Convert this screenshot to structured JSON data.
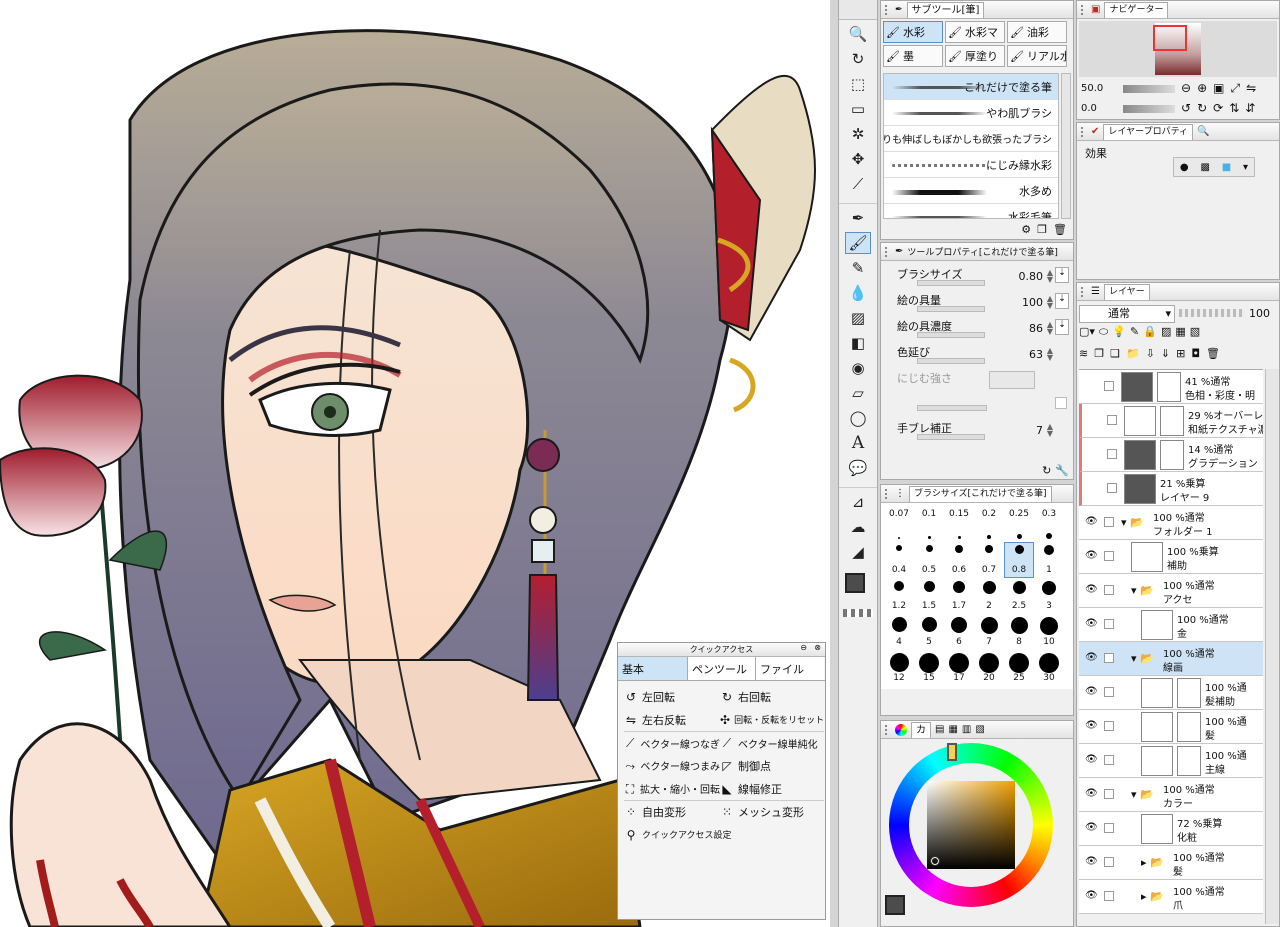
{
  "subtool": {
    "title": "サブツール[筆]",
    "groups": [
      "水彩",
      "水彩マ",
      "油彩",
      "墨",
      "厚塗り",
      "リアル水"
    ],
    "brushes": [
      "これだけで塗る筆",
      "やわ肌ブラシ",
      "塗りも伸ばしもぼかしも欲張ったブラシ",
      "にじみ縁水彩",
      "水多め",
      "水彩毛筆"
    ]
  },
  "navigator": {
    "title": "ナビゲーター",
    "zoom": "50.0",
    "rotation": "0.0"
  },
  "layer_property": {
    "title": "レイヤープロパティ",
    "effect_label": "効果"
  },
  "tool_property": {
    "title": "ツールプロパティ[これだけで塗る筆]",
    "props": [
      {
        "label": "ブラシサイズ",
        "value": "0.80"
      },
      {
        "label": "絵の具量",
        "value": "100"
      },
      {
        "label": "絵の具濃度",
        "value": "86"
      },
      {
        "label": "色延び",
        "value": "63"
      },
      {
        "label": "にじむ強さ",
        "value": ""
      },
      {
        "label": "手ブレ補正",
        "value": "7"
      }
    ]
  },
  "brush_size": {
    "title": "ブラシサイズ[これだけで塗る筆]",
    "sizes": [
      "0.07",
      "0.1",
      "0.15",
      "0.2",
      "0.25",
      "0.3",
      "0.4",
      "0.5",
      "0.6",
      "0.7",
      "0.8",
      "1",
      "1.2",
      "1.5",
      "1.7",
      "2",
      "2.5",
      "3",
      "4",
      "5",
      "6",
      "7",
      "8",
      "10",
      "12",
      "15",
      "17",
      "20",
      "25",
      "30"
    ],
    "selected": "0.8"
  },
  "color": {
    "tab_label": "カ"
  },
  "layers": {
    "title": "レイヤー",
    "blend_mode": "通常",
    "opacity": "100",
    "items": [
      {
        "line1": "41 %通常",
        "line2": "色相・彩度・明"
      },
      {
        "line1": "29 %オーバーレイ",
        "line2": "和紙テクスチャ濃"
      },
      {
        "line1": "14 %通常",
        "line2": "グラデーション"
      },
      {
        "line1": "21 %乗算",
        "line2": "レイヤー 9"
      },
      {
        "line1": "100 %通常",
        "line2": "フォルダー 1"
      },
      {
        "line1": "100 %乗算",
        "line2": "補助"
      },
      {
        "line1": "100 %通常",
        "line2": "アクセ"
      },
      {
        "line1": "100 %通常",
        "line2": "金"
      },
      {
        "line1": "100 %通常",
        "line2": "線画"
      },
      {
        "line1": "100 %通",
        "line2": "髪補助"
      },
      {
        "line1": "100 %通",
        "line2": "髪"
      },
      {
        "line1": "100 %通",
        "line2": "主線"
      },
      {
        "line1": "100 %通常",
        "line2": "カラー"
      },
      {
        "line1": "72 %乗算",
        "line2": "化粧"
      },
      {
        "line1": "100 %通常",
        "line2": "髪"
      },
      {
        "line1": "100 %通常",
        "line2": "爪"
      }
    ]
  },
  "quick_access": {
    "title": "クイックアクセス",
    "tabs": [
      "基本",
      "ペンツール",
      "ファイル"
    ],
    "items": [
      "左回転",
      "右回転",
      "左右反転",
      "回転・反転をリセット",
      "ベクター線つなぎ",
      "ベクター線単純化",
      "ベクター線つまみ",
      "制御点",
      "拡大・縮小・回転",
      "線幅修正",
      "自由変形",
      "メッシュ変形",
      "クイックアクセス設定"
    ]
  },
  "colors": {
    "accent": "#5a8fc7",
    "selection": "#cde4f7"
  }
}
